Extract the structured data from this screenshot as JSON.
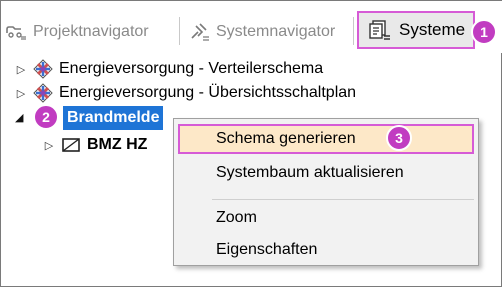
{
  "toolbar": {
    "tabs": [
      {
        "label": "Projektnavigator",
        "icon": "project-navigator-icon",
        "active": false
      },
      {
        "label": "Systemnavigator",
        "icon": "system-navigator-icon",
        "active": false
      },
      {
        "label": "Systeme",
        "icon": "systems-icon",
        "active": true
      }
    ]
  },
  "tree": {
    "items": [
      {
        "label": "Energieversorgung - Verteilerschema",
        "expanded": false,
        "icon": "schema-icon"
      },
      {
        "label": "Energieversorgung - Übersichtsschaltplan",
        "expanded": false,
        "icon": "schema-icon"
      },
      {
        "label": "Brandmelde",
        "expanded": true,
        "selected": true
      },
      {
        "label": "BMZ HZ",
        "expanded": false,
        "icon": "panel-icon"
      }
    ]
  },
  "context_menu": {
    "items": [
      {
        "label": "Schema generieren",
        "highlighted": true
      },
      {
        "label": "Systembaum aktualisieren"
      },
      {
        "label": "Zoom"
      },
      {
        "label": "Eigenschaften"
      }
    ]
  },
  "callouts": [
    "1",
    "2",
    "3"
  ],
  "colors": {
    "callout": "#c13cc1",
    "callout_border": "#d65bd6",
    "selection": "#1e74d6",
    "menu_highlight": "#fde8c8"
  }
}
